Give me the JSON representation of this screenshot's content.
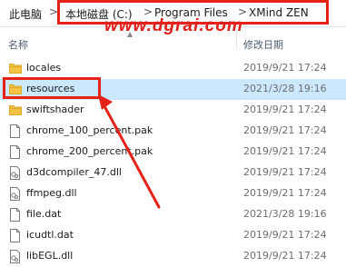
{
  "address": {
    "crumbs": [
      "此电脑",
      "本地磁盘 (C:)",
      "Program Files",
      "XMind ZEN"
    ],
    "separator": ">"
  },
  "watermark": "www.dgrai.com",
  "columns": {
    "name": "名称",
    "modified": "修改日期"
  },
  "files": [
    {
      "name": "locales",
      "date": "2019/9/21 17:24",
      "type": "folder",
      "icon": "folder-icon",
      "selected": false
    },
    {
      "name": "resources",
      "date": "2021/3/28 19:16",
      "type": "folder",
      "icon": "folder-icon",
      "selected": true
    },
    {
      "name": "swiftshader",
      "date": "2019/9/21 17:24",
      "type": "folder",
      "icon": "folder-icon",
      "selected": false
    },
    {
      "name": "chrome_100_percent.pak",
      "date": "2019/9/21 17:24",
      "type": "file",
      "icon": "file-icon",
      "selected": false
    },
    {
      "name": "chrome_200_percent.pak",
      "date": "2019/9/21 17:24",
      "type": "file",
      "icon": "file-icon",
      "selected": false
    },
    {
      "name": "d3dcompiler_47.dll",
      "date": "2019/9/21 17:24",
      "type": "dll",
      "icon": "dll-icon",
      "selected": false
    },
    {
      "name": "ffmpeg.dll",
      "date": "2019/9/21 17:24",
      "type": "dll",
      "icon": "dll-icon",
      "selected": false
    },
    {
      "name": "file.dat",
      "date": "2021/3/28 19:16",
      "type": "file",
      "icon": "file-icon",
      "selected": false
    },
    {
      "name": "icudtl.dat",
      "date": "2019/9/21 17:24",
      "type": "file",
      "icon": "file-icon",
      "selected": false
    },
    {
      "name": "libEGL.dll",
      "date": "2019/9/21 17:24",
      "type": "dll",
      "icon": "dll-icon",
      "selected": false
    }
  ],
  "colors": {
    "folder": "#f3c343",
    "folder_dark": "#dcaa2b",
    "selection": "#cce8ff",
    "annotation": "#e62117",
    "header_text": "#4d5b70"
  }
}
